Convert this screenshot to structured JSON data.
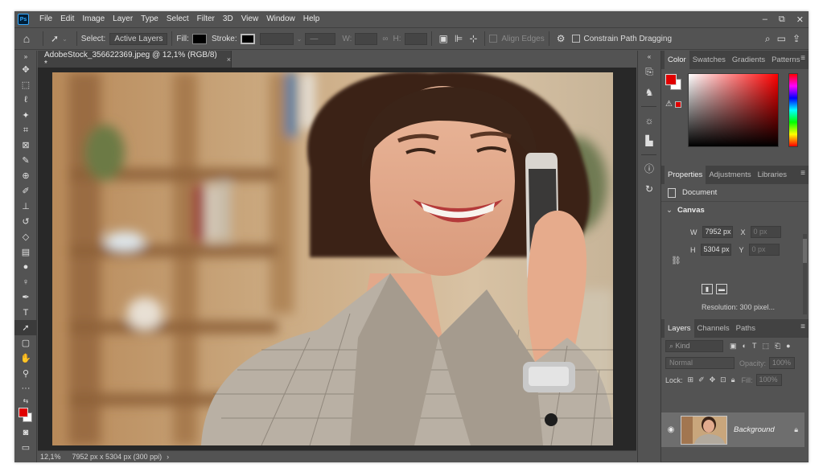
{
  "app": {
    "logo": "Ps"
  },
  "menu": [
    "File",
    "Edit",
    "Image",
    "Layer",
    "Type",
    "Select",
    "Filter",
    "3D",
    "View",
    "Window",
    "Help"
  ],
  "window_controls": {
    "minimize": "–",
    "restore": "⧉",
    "close": "✕"
  },
  "options_bar": {
    "select_label": "Select:",
    "select_value": "Active Layers",
    "fill_label": "Fill:",
    "stroke_label": "Stroke:",
    "w_label": "W:",
    "h_label": "H:",
    "align_edges": "Align Edges",
    "constrain": "Constrain Path Dragging"
  },
  "document_tab": {
    "title": "AdobeStock_356622369.jpeg @ 12,1% (RGB/8) *",
    "close": "×"
  },
  "status_bar": {
    "zoom": "12,1%",
    "info": "7952 px x 5304 px (300 ppi)",
    "arrow": "›"
  },
  "color_panel": {
    "tabs": [
      "Color",
      "Swatches",
      "Gradients",
      "Patterns"
    ],
    "active_tab": "Color",
    "foreground": "#e00000",
    "background": "#ffffff"
  },
  "properties_panel": {
    "tabs": [
      "Properties",
      "Adjustments",
      "Libraries"
    ],
    "active_tab": "Properties",
    "doc_label": "Document",
    "canvas_section": "Canvas",
    "w_label": "W",
    "w_value": "7952 px",
    "h_label": "H",
    "h_value": "5304 px",
    "x_label": "X",
    "x_value": "0 px",
    "y_label": "Y",
    "y_value": "0 px",
    "resolution": "Resolution: 300 pixel..."
  },
  "layers_panel": {
    "tabs": [
      "Layers",
      "Channels",
      "Paths"
    ],
    "active_tab": "Layers",
    "kind_placeholder": "Kind",
    "blend_mode": "Normal",
    "opacity_label": "Opacity:",
    "opacity_value": "100%",
    "lock_label": "Lock:",
    "fill_label": "Fill:",
    "fill_value": "100%",
    "layer_name": "Background",
    "footer_icons": [
      "link",
      "fx",
      "mask",
      "adjustment",
      "group",
      "new",
      "delete"
    ]
  },
  "colors": {
    "chrome": "#535353",
    "chrome_dark": "#424242",
    "canvas_bg": "#282828",
    "accent_red": "#e00000"
  }
}
